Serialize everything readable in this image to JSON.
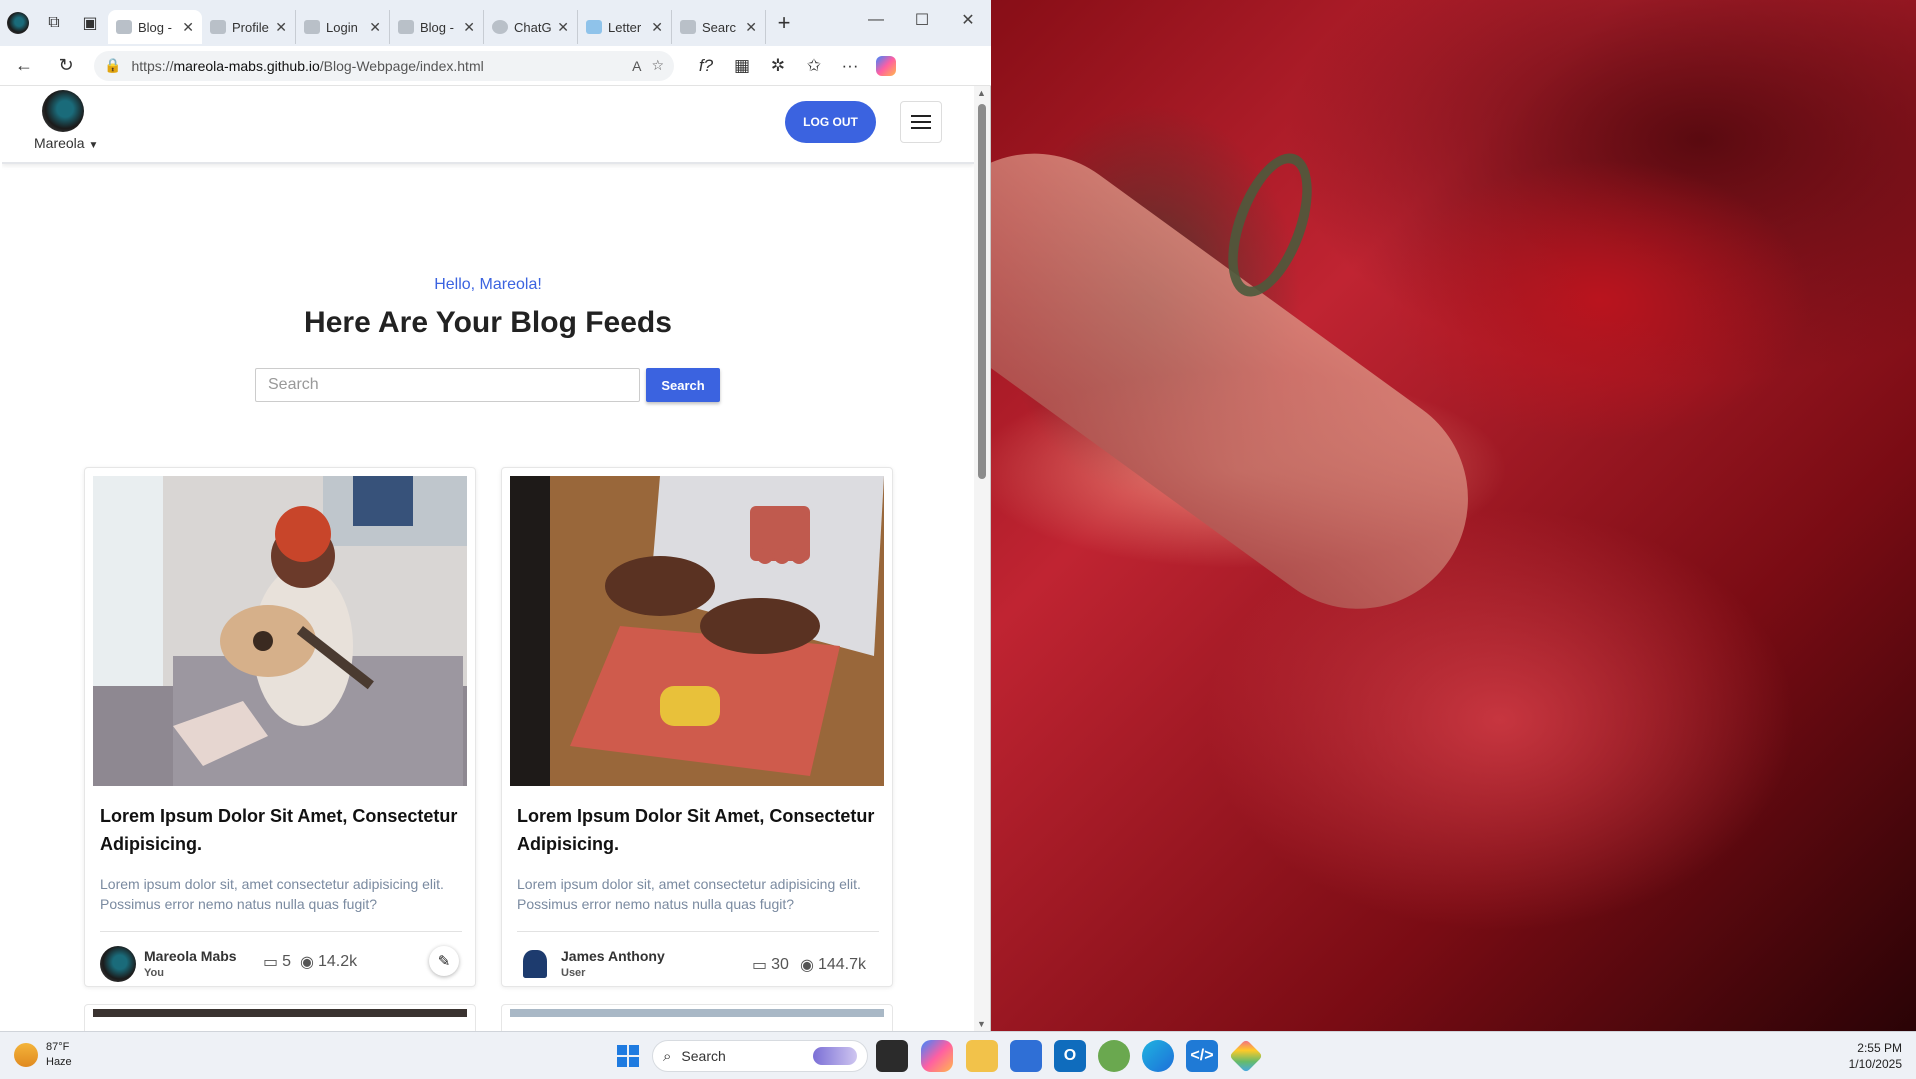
{
  "browser": {
    "tabs": [
      {
        "label": "Blog -",
        "active": true
      },
      {
        "label": "Profile",
        "active": false
      },
      {
        "label": "Login",
        "active": false
      },
      {
        "label": "Blog -",
        "active": false
      },
      {
        "label": "ChatG",
        "active": false
      },
      {
        "label": "Letter",
        "active": false
      },
      {
        "label": "Searc",
        "active": false
      }
    ],
    "url_prefix": "https://",
    "url_host": "mareola-mabs.github.io",
    "url_path": "/Blog-Webpage/index.html"
  },
  "site": {
    "profile_name": "Mareola",
    "logout_label": "LOG OUT",
    "greeting": "Hello, Mareola!",
    "feed_title": "Here Are Your Blog Feeds",
    "search_placeholder": "Search",
    "search_button": "Search",
    "posts": [
      {
        "title": "Lorem Ipsum Dolor Sit Amet, Consectetur Adipisicing.",
        "excerpt": "Lorem ipsum dolor sit, amet consectetur adipisicing elit. Possimus error nemo natus nulla quas fugit?",
        "author": "Mareola Mabs",
        "role": "You",
        "comments": "5",
        "views": "14.2k"
      },
      {
        "title": "Lorem Ipsum Dolor Sit Amet, Consectetur Adipisicing.",
        "excerpt": "Lorem ipsum dolor sit, amet consectetur adipisicing elit. Possimus error nemo natus nulla quas fugit?",
        "author": "James Anthony",
        "role": "User",
        "comments": "30",
        "views": "144.7k"
      }
    ]
  },
  "taskbar": {
    "temperature": "87°F",
    "condition": "Haze",
    "search_label": "Search",
    "time": "2:55 PM",
    "date": "1/10/2025"
  },
  "colors": {
    "accent": "#3b63e0",
    "excerpt": "#7a8aa0"
  }
}
